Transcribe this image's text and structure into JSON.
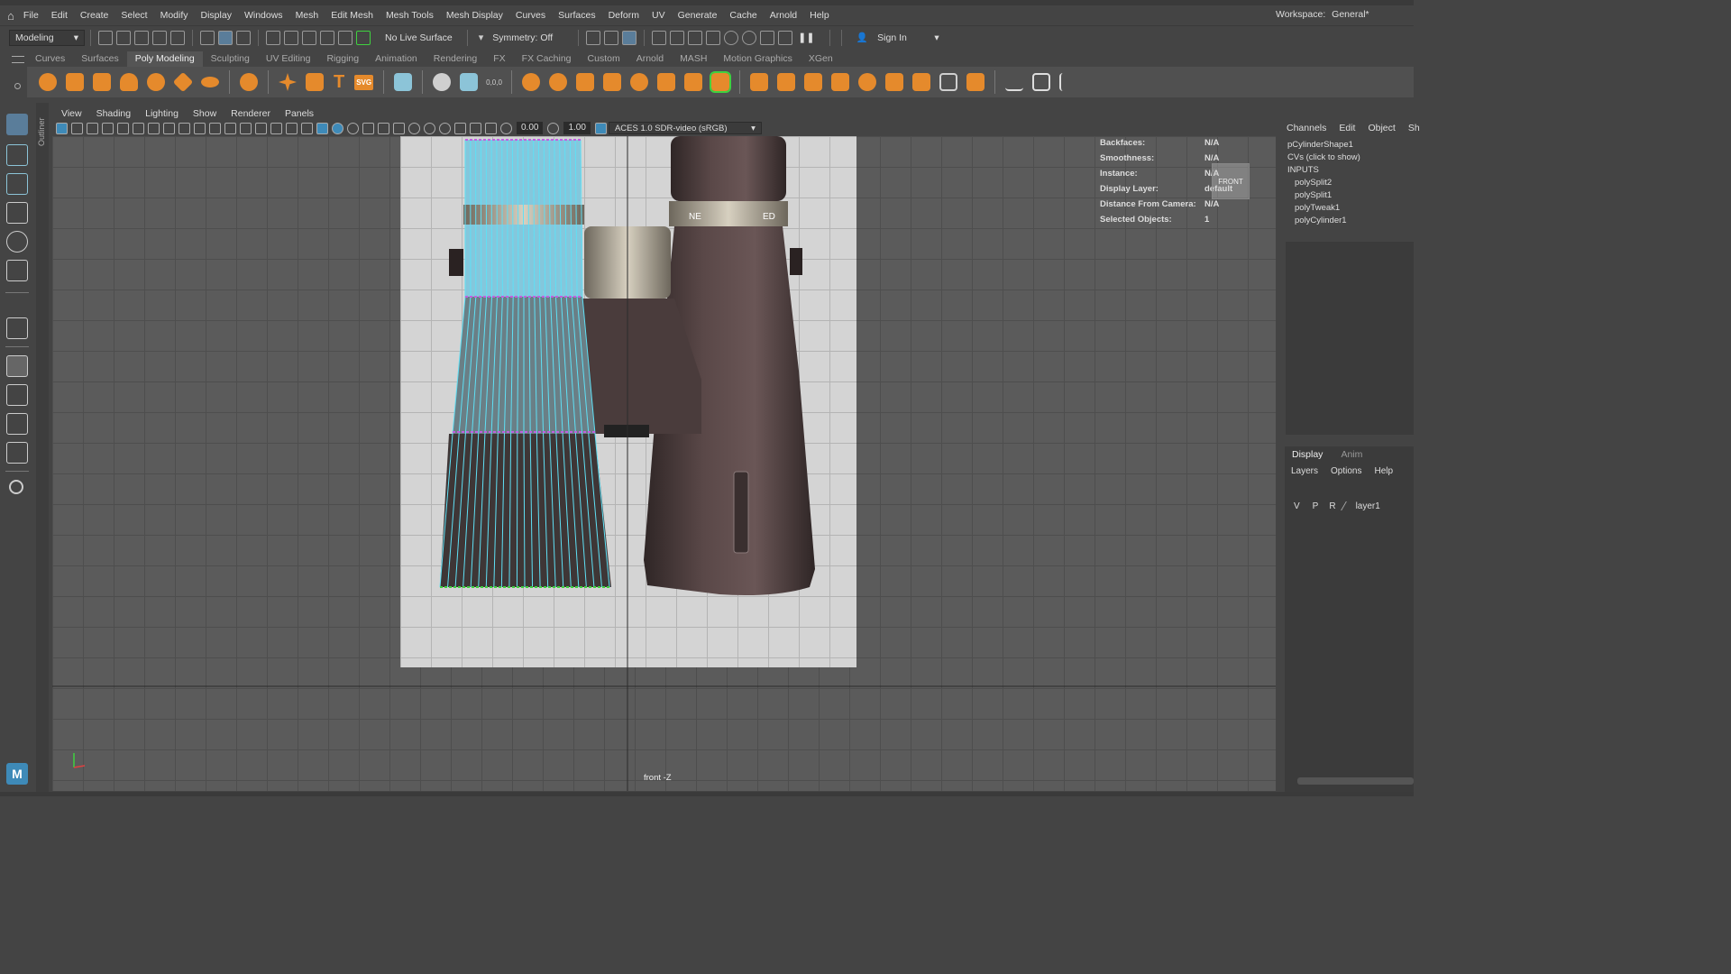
{
  "menubar": {
    "items": [
      "File",
      "Edit",
      "Create",
      "Select",
      "Modify",
      "Display",
      "Windows",
      "Mesh",
      "Edit Mesh",
      "Mesh Tools",
      "Mesh Display",
      "Curves",
      "Surfaces",
      "Deform",
      "UV",
      "Generate",
      "Cache",
      "Arnold",
      "Help"
    ],
    "workspace_label": "Workspace:",
    "workspace_value": "General*"
  },
  "statusline": {
    "mode": "Modeling",
    "live_surface": "No Live Surface",
    "symmetry": "Symmetry: Off",
    "signin": "Sign In"
  },
  "shelf": {
    "tabs": [
      "Curves",
      "Surfaces",
      "Poly Modeling",
      "Sculpting",
      "UV Editing",
      "Rigging",
      "Animation",
      "Rendering",
      "FX",
      "FX Caching",
      "Custom",
      "Arnold",
      "MASH",
      "Motion Graphics",
      "XGen"
    ],
    "active_tab": "Poly Modeling",
    "svg_label": "SVG",
    "text_label": "T",
    "coord_label": "0,0,0"
  },
  "outliner_label": "Outliner",
  "viewport": {
    "menu": [
      "View",
      "Shading",
      "Lighting",
      "Show",
      "Renderer",
      "Panels"
    ],
    "near_value": "0.00",
    "far_value": "1.00",
    "color_space": "ACES 1.0 SDR-video (sRGB)",
    "camera_label": "front -Z",
    "view_cube_label": "FRONT",
    "hud": [
      {
        "label": "Backfaces:",
        "value": "N/A"
      },
      {
        "label": "Smoothness:",
        "value": "N/A"
      },
      {
        "label": "Instance:",
        "value": "N/A"
      },
      {
        "label": "Display Layer:",
        "value": "default"
      },
      {
        "label": "Distance From Camera:",
        "value": "N/A"
      },
      {
        "label": "Selected Objects:",
        "value": "1"
      }
    ],
    "binocular_marks": [
      "NE",
      "ED"
    ]
  },
  "channelbox": {
    "tabs": [
      "Channels",
      "Edit",
      "Object",
      "Sh"
    ],
    "shape": "pCylinderShape1",
    "cvs": "CVs (click to show)",
    "inputs_label": "INPUTS",
    "inputs": [
      "polySplit2",
      "polySplit1",
      "polyTweak1",
      "polyCylinder1"
    ]
  },
  "layers": {
    "tabs": [
      "Display",
      "Anim"
    ],
    "menu": [
      "Layers",
      "Options",
      "Help"
    ],
    "row": {
      "v": "V",
      "p": "P",
      "r": "R",
      "name": "layer1"
    }
  }
}
